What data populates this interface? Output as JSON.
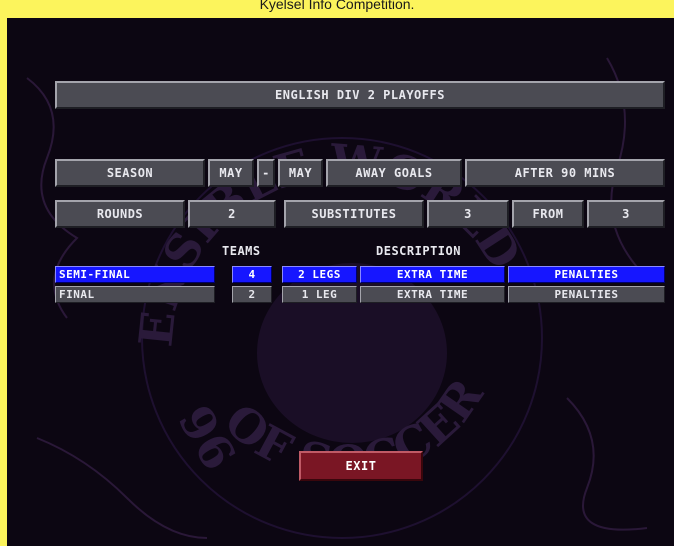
{
  "caption": "Kyelsel Info Competition.",
  "competition_name": "ENGLISH DIV 2 PLAYOFFS",
  "settings": {
    "season_label": "SEASON",
    "season_start": "MAY",
    "season_dash": "-",
    "season_end": "MAY",
    "away_goals_label": "AWAY GOALS",
    "away_goals_value": "AFTER 90 MINS",
    "rounds_label": "ROUNDS",
    "rounds_value": "2",
    "substitutes_label": "SUBSTITUTES",
    "substitutes_value": "3",
    "from_label": "FROM",
    "from_value": "3"
  },
  "table_headers": {
    "teams": "TEAMS",
    "description": "DESCRIPTION"
  },
  "rounds": [
    {
      "name": "SEMI-FINAL",
      "teams": "4",
      "legs": "2 LEGS",
      "extra": "EXTRA TIME",
      "tiebreak": "PENALTIES",
      "selected": true
    },
    {
      "name": "FINAL",
      "teams": "2",
      "legs": "1 LEG",
      "extra": "EXTRA TIME",
      "tiebreak": "PENALTIES",
      "selected": false
    }
  ],
  "crest_text": {
    "top": "ENSIBLE WORLD",
    "bottom": "OF SOCCER",
    "year": "96"
  },
  "exit_label": "EXIT",
  "colors": {
    "frame": "#fcf45c",
    "background": "#0c0612",
    "button": "#4b4b53",
    "selected": "#1616ff",
    "exit": "#7a1624"
  }
}
